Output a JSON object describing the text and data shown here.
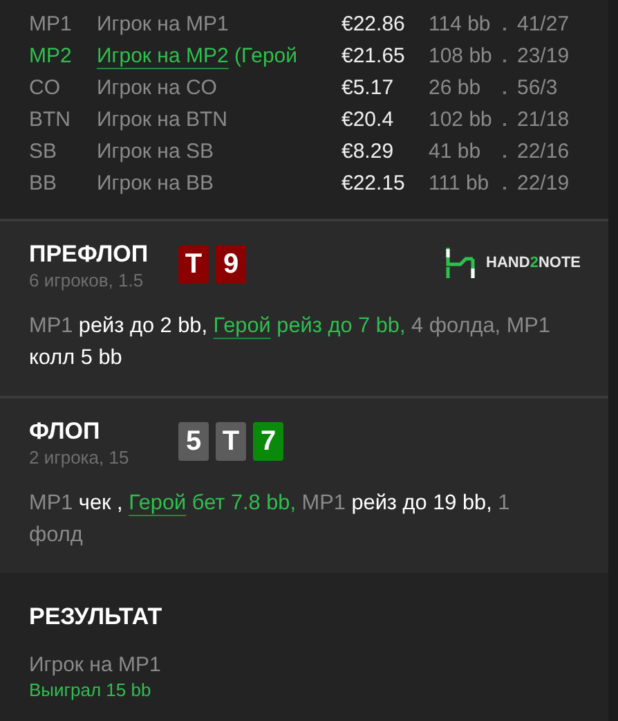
{
  "players": [
    {
      "position": "MP1",
      "name": "Игрок на MP1",
      "hero": false,
      "stack": "€22.86",
      "bb": "114 bb",
      "stats": "41/27"
    },
    {
      "position": "MP2",
      "name": "Игрок на MP2",
      "hero": true,
      "hero_tag": "(Герой",
      "stack": "€21.65",
      "bb": "108 bb",
      "stats": "23/19"
    },
    {
      "position": "CO",
      "name": "Игрок на CO",
      "hero": false,
      "stack": "€5.17",
      "bb": "26 bb",
      "stats": "56/3"
    },
    {
      "position": "BTN",
      "name": "Игрок на BTN",
      "hero": false,
      "stack": "€20.4",
      "bb": "102 bb",
      "stats": "21/18"
    },
    {
      "position": "SB",
      "name": "Игрок на SB",
      "hero": false,
      "stack": "€8.29",
      "bb": "41 bb",
      "stats": "22/16"
    },
    {
      "position": "BB",
      "name": "Игрок на BB",
      "hero": false,
      "stack": "€22.15",
      "bb": "111 bb",
      "stats": "22/19"
    }
  ],
  "streets": [
    {
      "title": "ПРЕФЛОП",
      "subtitle": "6 игроков, 1.5",
      "cards": [
        {
          "rank": "T",
          "color": "#8b0000"
        },
        {
          "rank": "9",
          "color": "#8b0000"
        }
      ],
      "logo": {
        "before": "HAND",
        "accent": "2",
        "after": "NOTE"
      },
      "actions": [
        {
          "kind": "player",
          "text": "MP1 "
        },
        {
          "kind": "action",
          "text": "рейз до 2 bb, "
        },
        {
          "kind": "hero",
          "text": "Герой"
        },
        {
          "kind": "hero_action",
          "text": " рейз до 7 bb, "
        },
        {
          "kind": "other",
          "text": "4 фолда, MP1 "
        },
        {
          "kind": "action",
          "text": "колл 5 bb"
        }
      ]
    },
    {
      "title": "ФЛОП",
      "subtitle": "2 игрока, 15",
      "cards": [
        {
          "rank": "5",
          "color": "#5c5c5c"
        },
        {
          "rank": "T",
          "color": "#5c5c5c"
        },
        {
          "rank": "7",
          "color": "#0a8a0a"
        }
      ],
      "actions": [
        {
          "kind": "player",
          "text": "MP1 "
        },
        {
          "kind": "action",
          "text": "чек , "
        },
        {
          "kind": "hero",
          "text": "Герой"
        },
        {
          "kind": "hero_action",
          "text": " бет 7.8 bb, "
        },
        {
          "kind": "player",
          "text": "MP1 "
        },
        {
          "kind": "action",
          "text": "рейз до 19 bb, "
        },
        {
          "kind": "other",
          "text": "1 фолд"
        }
      ]
    }
  ],
  "result": {
    "title": "РЕЗУЛЬТАТ",
    "player": "Игрок на MP1",
    "outcome": "Выиграл 15 bb"
  }
}
